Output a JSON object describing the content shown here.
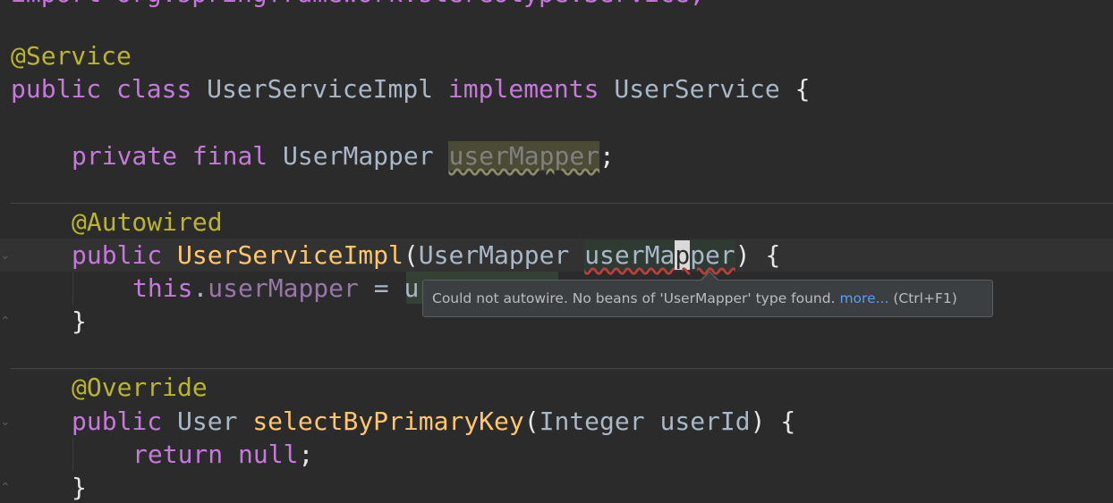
{
  "code": {
    "top_partial": "import org.springframework.stereotype.Service;",
    "annotation_service": "@Service",
    "line_class": {
      "public": "public",
      "class": "class",
      "name": "UserServiceImpl",
      "implements": "implements",
      "iface": "UserService",
      "brace": "{"
    },
    "line_field": {
      "private": "private",
      "final": "final",
      "type": "UserMapper",
      "name": "userMapper",
      "semi": ";"
    },
    "annotation_autowired": "@Autowired",
    "line_ctor": {
      "public": "public",
      "name": "UserServiceImpl",
      "open": "(",
      "param_type": "UserMapper",
      "param_pre": "userMa",
      "param_caret": "p",
      "param_post": "per",
      "close": ")",
      "brace": "{"
    },
    "line_assign": {
      "this": "this",
      "dot": ".",
      "field": "userMapper",
      "eq": " = ",
      "value_visible": "u"
    },
    "close_brace_1": "}",
    "annotation_override": "@Override",
    "line_method": {
      "public": "public",
      "ret": "User",
      "name": "selectByPrimaryKey",
      "open": "(",
      "param_type": "Integer",
      "param_name": "userId",
      "close": ")",
      "brace": "{"
    },
    "line_return": {
      "return": "return",
      "null": "null",
      "semi": ";"
    },
    "close_brace_2": "}"
  },
  "tooltip": {
    "message": "Could not autowire. No beans of 'UserMapper' type found.",
    "link": "more...",
    "shortcut": "(Ctrl+F1)"
  },
  "colors": {
    "background": "#2b2b2b",
    "keyword": "#c678dd",
    "annotation": "#bbb529",
    "field": "#9876aa",
    "method": "#ffc66d",
    "error_underline": "#bc3f3c",
    "link": "#589df6"
  }
}
